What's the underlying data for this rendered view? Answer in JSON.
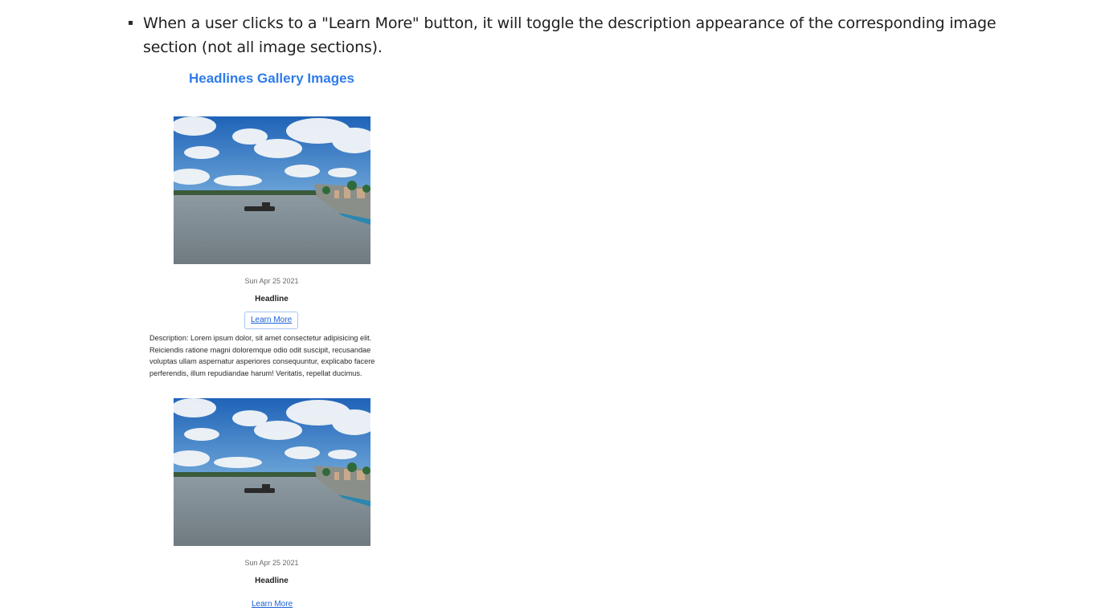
{
  "instruction": {
    "text": "When a user clicks to a \"Learn More\" button, it will toggle the description appearance of the corresponding image section (not all image sections)."
  },
  "gallery": {
    "title": "Headlines Gallery Images",
    "cards": [
      {
        "date": "Sun Apr 25 2021",
        "headline": "Headline",
        "learn_more_label": "Learn More",
        "description_visible": true,
        "description": "Description: Lorem ipsum dolor, sit amet consectetur adipisicing elit. Reiciendis ratione magni doloremque odio odit suscipit, recusandae voluptas ullam aspernatur asperiores consequuntur, explicabo facere perferendis, illum repudiandae harum! Veritatis, repellat ducimus."
      },
      {
        "date": "Sun Apr 25 2021",
        "headline": "Headline",
        "learn_more_label": "Learn More",
        "description_visible": false
      }
    ]
  },
  "colors": {
    "title_blue": "#2f7bea",
    "link_blue": "#1a5fd6",
    "focus_ring": "#a9c7f2"
  }
}
